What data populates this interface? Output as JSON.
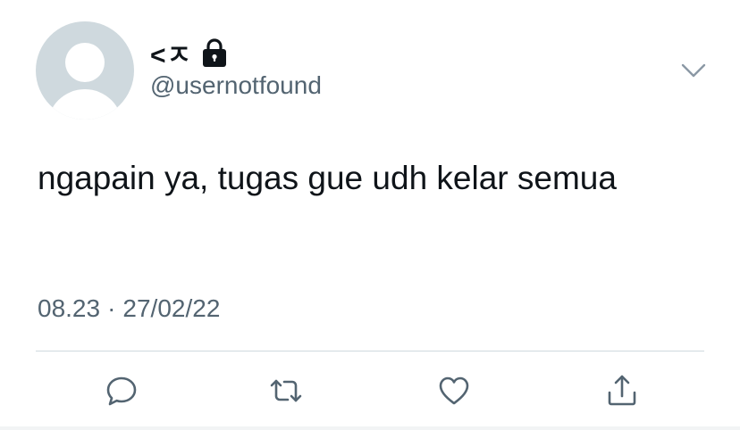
{
  "tweet": {
    "author": {
      "display_name": "<ㅈ",
      "handle": "@usernotfound",
      "protected": true
    },
    "text": "ngapain ya, tugas gue udh kelar semua",
    "time": "08.23",
    "separator": "·",
    "date": "27/02/22"
  },
  "icons": {
    "lock": "lock-icon",
    "more": "chevron-down-icon",
    "reply": "reply-icon",
    "retweet": "retweet-icon",
    "like": "heart-icon",
    "share": "share-icon"
  },
  "colors": {
    "text_primary": "#0f1419",
    "text_secondary": "#536471",
    "divider": "#cfd9de",
    "avatar_bg": "#cfd9de",
    "icon": "#536471"
  }
}
